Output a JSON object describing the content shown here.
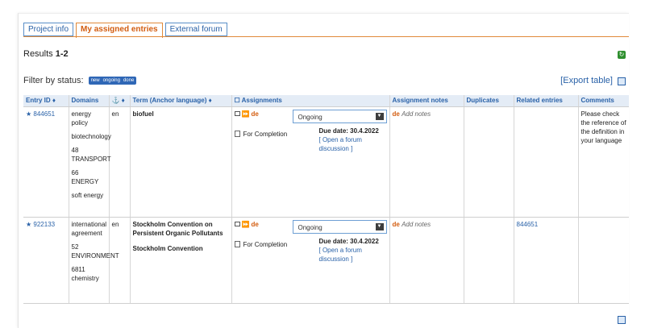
{
  "tabs": [
    {
      "label": "Project info"
    },
    {
      "label": "My assigned entries"
    },
    {
      "label": "External forum"
    }
  ],
  "results": {
    "prefix": "Results ",
    "range": "1-2"
  },
  "filter": {
    "label": "Filter by status:",
    "statuses": [
      "new",
      "ongoing",
      "done"
    ]
  },
  "export_label": "[Export table]",
  "table": {
    "headers": [
      "Entry ID ♦",
      "Domains",
      "⚓ ♦",
      "Term (Anchor language) ♦",
      "☐ Assignments",
      "Assignment notes",
      "Duplicates",
      "Related entries",
      "Comments"
    ],
    "rows": [
      {
        "entry_id": "844651",
        "domains": [
          "energy policy",
          "biotechnology",
          "48 TRANSPORT",
          "66 ENERGY",
          "soft energy"
        ],
        "lang": "en",
        "term": "biofuel",
        "term_sub": "",
        "assign_lang": "de",
        "status": "Ongoing",
        "completion": "For Completion",
        "due": "Due date: 30.4.2022",
        "forum": "[ Open a forum discussion ]",
        "note_lang": "de",
        "note_add": "Add notes",
        "duplicates": "",
        "related": "",
        "comments": "Please check the reference of the definition in your language"
      },
      {
        "entry_id": "922133",
        "domains": [
          "international agreement",
          "52 ENVIRONMENT",
          "6811 chemistry"
        ],
        "lang": "en",
        "term": "Stockholm Convention on Persistent Organic Pollutants",
        "term_sub": "Stockholm Convention",
        "assign_lang": "de",
        "status": "Ongoing",
        "completion": "For Completion",
        "due": "Due date: 30.4.2022",
        "forum": "[ Open a forum discussion ]",
        "note_lang": "de",
        "note_add": "Add notes",
        "duplicates": "",
        "related": "844651",
        "comments": ""
      }
    ]
  },
  "icons": {
    "refresh": "refresh-icon",
    "export": "export-icon",
    "star": "star-icon"
  },
  "colors": {
    "accent": "#2a62a8",
    "active_tab": "#d35d10",
    "header_bg": "#e4ecf6"
  }
}
